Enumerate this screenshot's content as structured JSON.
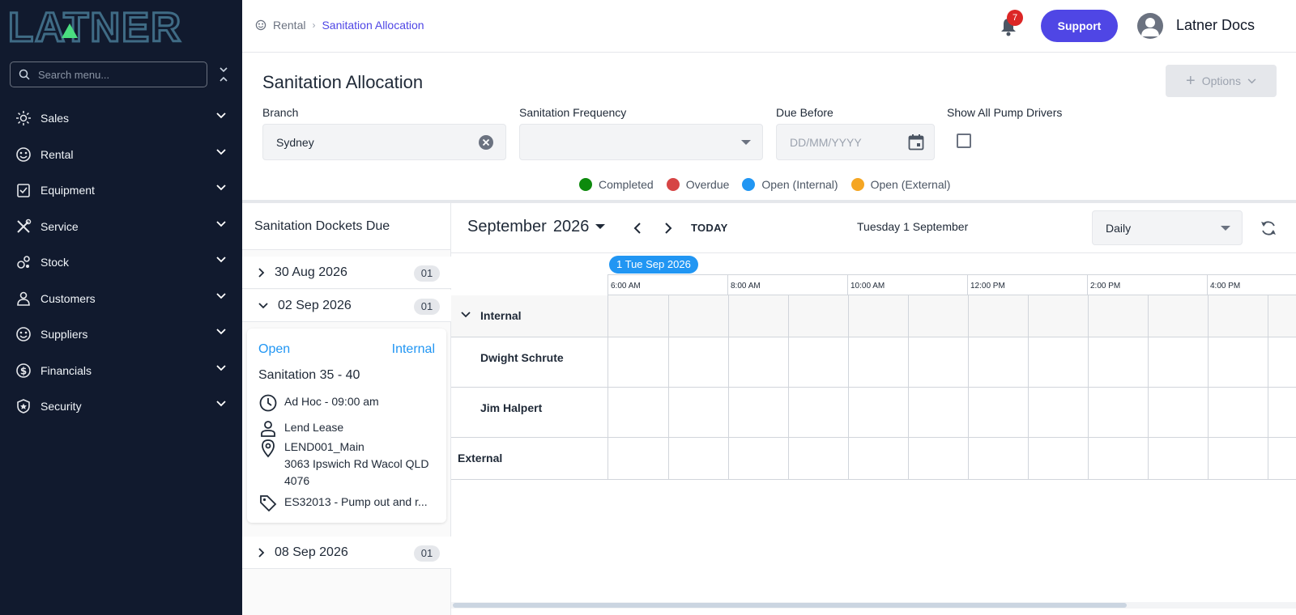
{
  "app": {
    "logo_text": "LATNER"
  },
  "sidebar": {
    "search_placeholder": "Search menu...",
    "items": [
      {
        "label": "Sales",
        "icon": "sales-icon"
      },
      {
        "label": "Rental",
        "icon": "rental-icon"
      },
      {
        "label": "Equipment",
        "icon": "equipment-icon"
      },
      {
        "label": "Service",
        "icon": "service-icon"
      },
      {
        "label": "Stock",
        "icon": "stock-icon"
      },
      {
        "label": "Customers",
        "icon": "customers-icon"
      },
      {
        "label": "Suppliers",
        "icon": "suppliers-icon"
      },
      {
        "label": "Financials",
        "icon": "financials-icon"
      },
      {
        "label": "Security",
        "icon": "security-icon"
      }
    ]
  },
  "topbar": {
    "breadcrumb": [
      "Rental",
      "Sanitation Allocation"
    ],
    "notification_count": "7",
    "support_label": "Support",
    "user_name": "Latner Docs"
  },
  "page": {
    "title": "Sanitation Allocation",
    "options_label": "Options"
  },
  "filters": {
    "branch_label": "Branch",
    "branch_value": "Sydney",
    "frequency_label": "Sanitation Frequency",
    "frequency_value": "",
    "due_label": "Due Before",
    "due_placeholder": "DD/MM/YYYY",
    "show_drivers_label": "Show All Pump Drivers",
    "show_drivers_checked": false
  },
  "legend": [
    {
      "label": "Completed",
      "color": "#0d8a0d"
    },
    {
      "label": "Overdue",
      "color": "#d64545"
    },
    {
      "label": "Open (Internal)",
      "color": "#2196f3"
    },
    {
      "label": "Open (External)",
      "color": "#f5a623"
    }
  ],
  "dockets": {
    "title": "Sanitation Dockets Due",
    "groups": [
      {
        "date": "30 Aug 2026",
        "count": "01",
        "expanded": false
      },
      {
        "date": "02 Sep 2026",
        "count": "01",
        "expanded": true
      },
      {
        "date": "08 Sep 2026",
        "count": "01",
        "expanded": false
      }
    ],
    "card": {
      "status": "Open",
      "type": "Internal",
      "title": "Sanitation 35 - 40",
      "schedule": "Ad Hoc - 09:00 am",
      "customer": "Lend Lease",
      "site_code": "LEND001_Main",
      "address": "3063 Ipswich Rd Wacol QLD 4076",
      "item": "ES32013 - Pump out and r..."
    }
  },
  "calendar": {
    "month": "September",
    "year": "2026",
    "today_label": "TODAY",
    "current_date": "Tuesday 1 September",
    "view": "Daily",
    "date_chip": "1 Tue Sep 2026",
    "time_labels": [
      "6:00 AM",
      "8:00 AM",
      "10:00 AM",
      "12:00 PM",
      "2:00 PM",
      "4:00 PM"
    ],
    "rows": [
      {
        "label": "Internal",
        "kind": "group"
      },
      {
        "label": "Dwight Schrute",
        "kind": "resource"
      },
      {
        "label": "Jim Halpert",
        "kind": "resource"
      },
      {
        "label": "External",
        "kind": "group-flat"
      }
    ]
  }
}
